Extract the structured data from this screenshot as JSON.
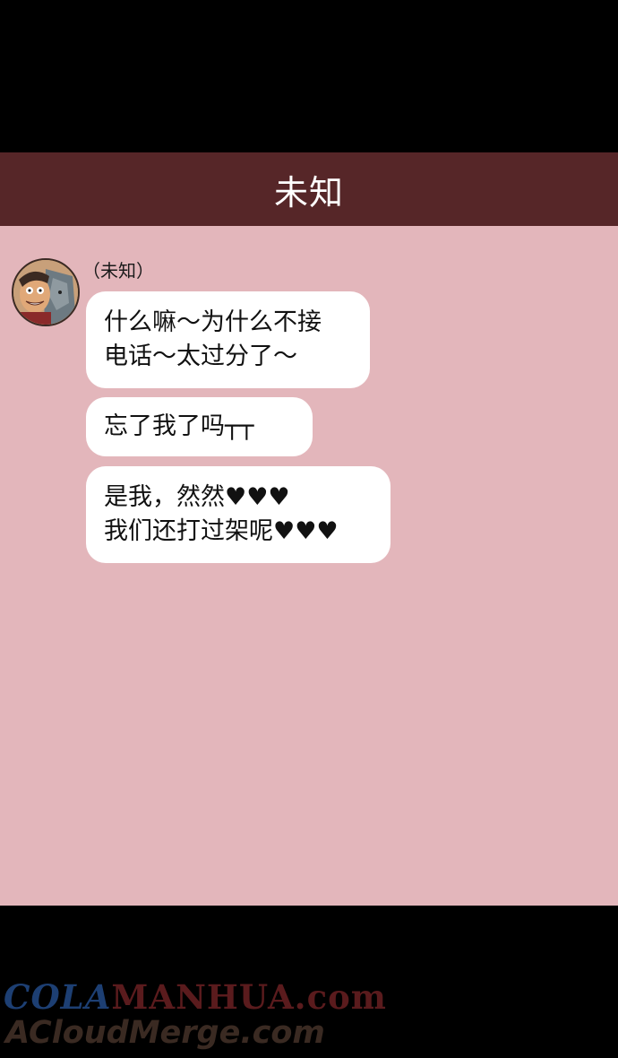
{
  "header": {
    "title": "未知"
  },
  "message_group": {
    "sender_name": "（未知）",
    "messages": [
      {
        "lines": [
          "什么嘛～为什么不接",
          "电话～太过分了～"
        ]
      },
      {
        "lines": [
          "忘了我了吗┬┬"
        ]
      },
      {
        "lines": [
          "是我，然然♥♥♥",
          "我们还打过架呢♥♥♥"
        ]
      }
    ]
  },
  "watermark": {
    "line1_part1": "COLA",
    "line1_part2": "MANHUA.com",
    "line2": "ACloudMerge.com"
  },
  "colors": {
    "header_bg": "#562628",
    "chat_bg": "#e3b6bb",
    "bubble_bg": "#ffffff"
  }
}
